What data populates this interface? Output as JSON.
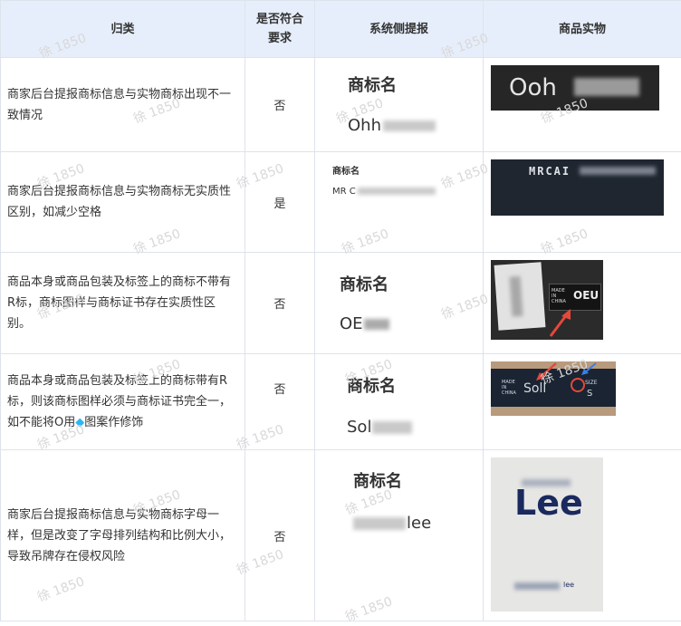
{
  "headers": {
    "category": "归类",
    "compliance": "是否符合要求",
    "system": "系统侧提报",
    "product": "商品实物"
  },
  "rows": [
    {
      "category": "商家后台提报商标信息与实物商标出现不一致情况",
      "compliant": "否",
      "label": "商标名",
      "value": "Ohh",
      "photo_text": "Ooh"
    },
    {
      "category": "商家后台提报商标信息与实物商标无实质性区别，如减少空格",
      "compliant": "是",
      "label": "商标名",
      "value": "MR C",
      "photo_text": "MRCAI"
    },
    {
      "category": "商品本身或商品包装及标签上的商标不带有R标，商标图样与商标证书存在实质性区别。",
      "compliant": "否",
      "label": "商标名",
      "value": "OE",
      "photo_text": "OEU",
      "photo_small": "MADE IN CHINA"
    },
    {
      "category_part1": "商品本身或商品包装及标签上的商标带有R标，则该商标图样必须与商标证书完全一，如不能将O用",
      "category_part2": "图案作修饰",
      "compliant": "否",
      "label": "商标名",
      "value": "Sol",
      "photo_text": "Soll",
      "photo_small": "MADE IN CHINA",
      "photo_size": "SIZE",
      "photo_size_value": "S"
    },
    {
      "category": "商家后台提报商标信息与实物商标字母一样，但是改变了字母排列结构和比例大小，导致吊牌存在侵权风险",
      "compliant": "否",
      "label": "商标名",
      "value": "lee",
      "photo_text": "Lee",
      "photo_small": "lee"
    }
  ],
  "watermark": "徐 1850",
  "colors": {
    "header_bg": "#e7eefb",
    "border": "#dde3ec",
    "diamond": "#2fb6f0",
    "arrow_red": "#e5483a",
    "arrow_blue": "#3a7fe5"
  }
}
